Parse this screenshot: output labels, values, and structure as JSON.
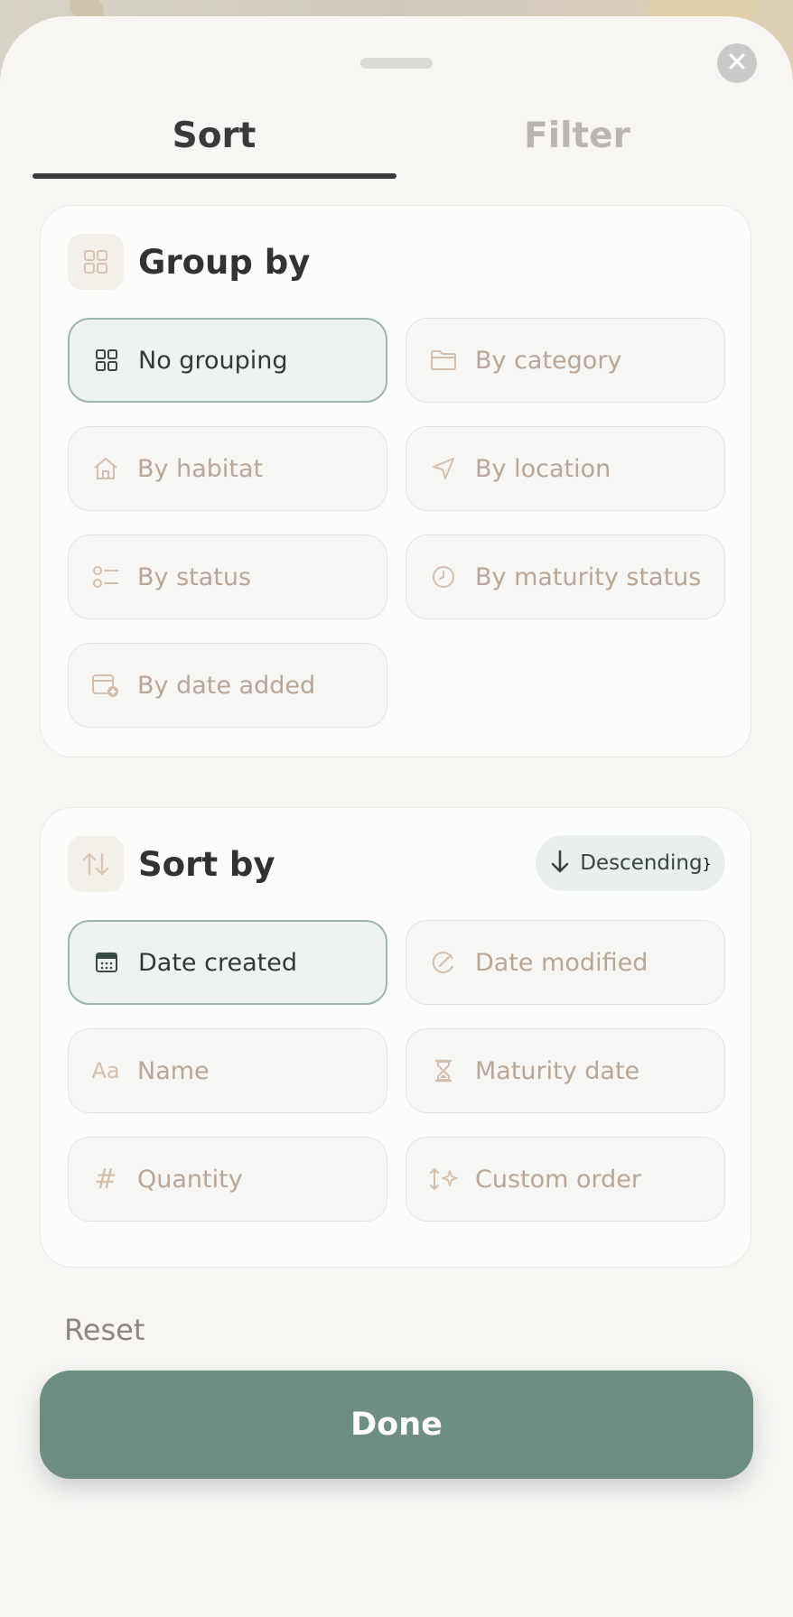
{
  "tabs": {
    "sort_label": "Sort",
    "filter_label": "Filter"
  },
  "group_by": {
    "title": "Group by",
    "options": [
      {
        "label": "No grouping",
        "icon": "grid-icon",
        "selected": true
      },
      {
        "label": "By category",
        "icon": "folder-icon",
        "selected": false
      },
      {
        "label": "By habitat",
        "icon": "house-icon",
        "selected": false
      },
      {
        "label": "By location",
        "icon": "location-arrow-icon",
        "selected": false
      },
      {
        "label": "By status",
        "icon": "checklist-icon",
        "selected": false
      },
      {
        "label": "By maturity status",
        "icon": "clock-icon",
        "selected": false
      },
      {
        "label": "By date added",
        "icon": "calendar-add-icon",
        "selected": false
      }
    ]
  },
  "sort_by": {
    "title": "Sort by",
    "order_label": "Descending",
    "options": [
      {
        "label": "Date created",
        "icon": "calendar-icon",
        "selected": true
      },
      {
        "label": "Date modified",
        "icon": "edit-clock-icon",
        "selected": false
      },
      {
        "label": "Name",
        "icon": "text-aa-icon",
        "glyph": "Aa",
        "selected": false
      },
      {
        "label": "Maturity date",
        "icon": "hourglass-icon",
        "selected": false
      },
      {
        "label": "Quantity",
        "icon": "hash-icon",
        "glyph": "#",
        "selected": false
      },
      {
        "label": "Custom order",
        "icon": "sort-sparkle-icon",
        "selected": false
      }
    ]
  },
  "footer": {
    "reset_label": "Reset",
    "done_label": "Done"
  },
  "colors": {
    "accent": "#6e8d83",
    "selected_bg": "#eef3ef",
    "muted_text": "#b8a696"
  }
}
